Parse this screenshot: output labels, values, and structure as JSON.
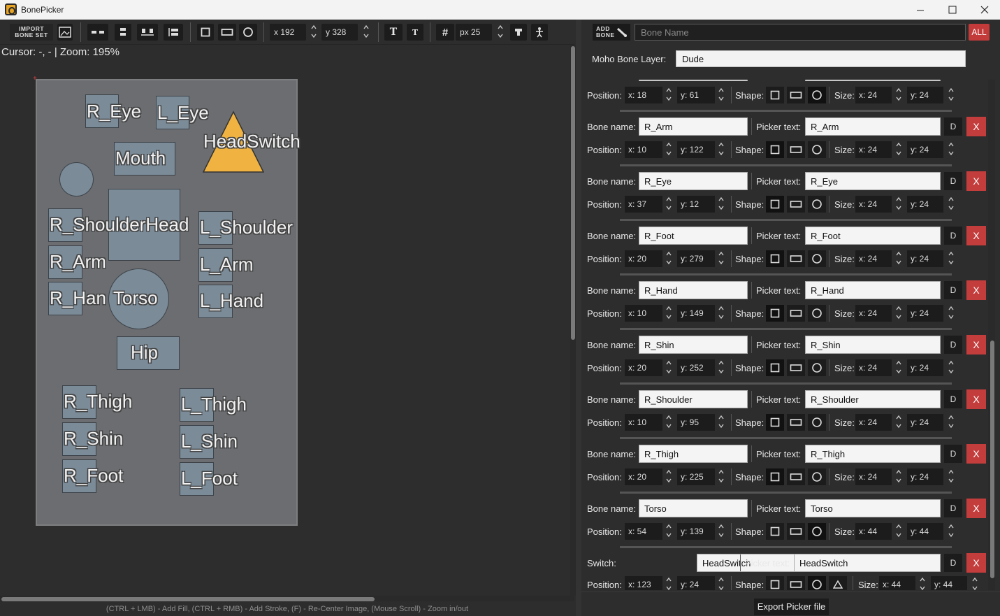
{
  "window": {
    "title": "BonePicker",
    "minimize": "—",
    "maximize": "☐",
    "close": "✕"
  },
  "toolbar": {
    "import_label": "IMPORT BONE SET",
    "x_value": "x 192",
    "y_value": "y 328",
    "grid_value": "px 25"
  },
  "canvas": {
    "cursor_info": "Cursor: -, - | Zoom: 195%",
    "hint": "(CTRL + LMB) - Add Fill, (CTRL + RMB) - Add Stroke, (F) - Re-Center Image, (Mouse Scroll) - Zoom in/out",
    "labels": [
      "R_Eye",
      "L_Eye",
      "HeadSwitch",
      "Mouth",
      "R_ShoulderHead",
      "L_Shoulder",
      "R_Arm",
      "L_Arm",
      "R_Han",
      "Torso",
      "L_Hand",
      "Hip",
      "R_Thigh",
      "L_Thigh",
      "R_Shin",
      "L_Shin",
      "R_Foot",
      "L_Foot"
    ],
    "switch_color": "#f0b341"
  },
  "panel": {
    "add_bone_label": "ADD BONE",
    "bone_name_placeholder": "Bone Name",
    "all_label": "ALL",
    "layer_label": "Moho Bone Layer:",
    "layer_value": "Dude",
    "labels": {
      "bone_name": "Bone name:",
      "picker_text": "Picker text:",
      "position": "Position:",
      "shape": "Shape:",
      "size": "Size:",
      "switch": "Switch:",
      "d": "D",
      "x": "X"
    },
    "partial_row": {
      "x": "x: 18",
      "y": "y: 61",
      "sx": "x: 24",
      "sy": "y: 24"
    },
    "rows": [
      {
        "name": "R_Arm",
        "picker": "R_Arm",
        "x": "x: 10",
        "y": "y: 122",
        "sx": "x: 24",
        "sy": "y: 24",
        "shape": "square"
      },
      {
        "name": "R_Eye",
        "picker": "R_Eye",
        "x": "x: 37",
        "y": "y: 12",
        "sx": "x: 24",
        "sy": "y: 24",
        "shape": "square"
      },
      {
        "name": "R_Foot",
        "picker": "R_Foot",
        "x": "x: 20",
        "y": "y: 279",
        "sx": "x: 24",
        "sy": "y: 24",
        "shape": "square"
      },
      {
        "name": "R_Hand",
        "picker": "R_Hand",
        "x": "x: 10",
        "y": "y: 149",
        "sx": "x: 24",
        "sy": "y: 24",
        "shape": "square"
      },
      {
        "name": "R_Shin",
        "picker": "R_Shin",
        "x": "x: 20",
        "y": "y: 252",
        "sx": "x: 24",
        "sy": "y: 24",
        "shape": "square"
      },
      {
        "name": "R_Shoulder",
        "picker": "R_Shoulder",
        "x": "x: 10",
        "y": "y: 95",
        "sx": "x: 24",
        "sy": "y: 24",
        "shape": "square"
      },
      {
        "name": "R_Thigh",
        "picker": "R_Thigh",
        "x": "x: 20",
        "y": "y: 225",
        "sx": "x: 24",
        "sy": "y: 24",
        "shape": "square"
      },
      {
        "name": "Torso",
        "picker": "Torso",
        "x": "x: 54",
        "y": "y: 139",
        "sx": "x: 44",
        "sy": "y: 44",
        "shape": "circle"
      }
    ],
    "switch_row": {
      "name": "HeadSwitch",
      "picker": "HeadSwitch",
      "x": "x: 123",
      "y": "y: 24",
      "sx": "x: 44",
      "sy": "y: 44"
    },
    "export_label": "Export Picker file"
  }
}
